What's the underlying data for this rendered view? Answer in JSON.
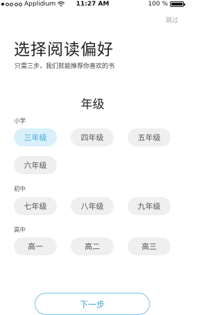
{
  "status_bar": {
    "carrier": "Applidium",
    "time": "11:27 AM",
    "battery_text": "100 %",
    "battery_level": 1.0
  },
  "header": {
    "skip_label": "跳过",
    "title": "选择阅读偏好",
    "subtitle": "只需三步，我们就能推荐你喜欢的书"
  },
  "section": {
    "heading": "年级"
  },
  "groups": [
    {
      "label": "小学",
      "options": [
        "三年级",
        "四年级",
        "五年级",
        "六年级"
      ]
    },
    {
      "label": "初中",
      "options": [
        "七年级",
        "八年级",
        "九年级"
      ]
    },
    {
      "label": "高中",
      "options": [
        "高一",
        "高二",
        "高三"
      ]
    }
  ],
  "selected_option": "三年级",
  "footer": {
    "next_label": "下一步"
  },
  "colors": {
    "accent": "#45a8de",
    "selected_bg": "#d9f0fb",
    "chip_bg": "#efefef"
  }
}
